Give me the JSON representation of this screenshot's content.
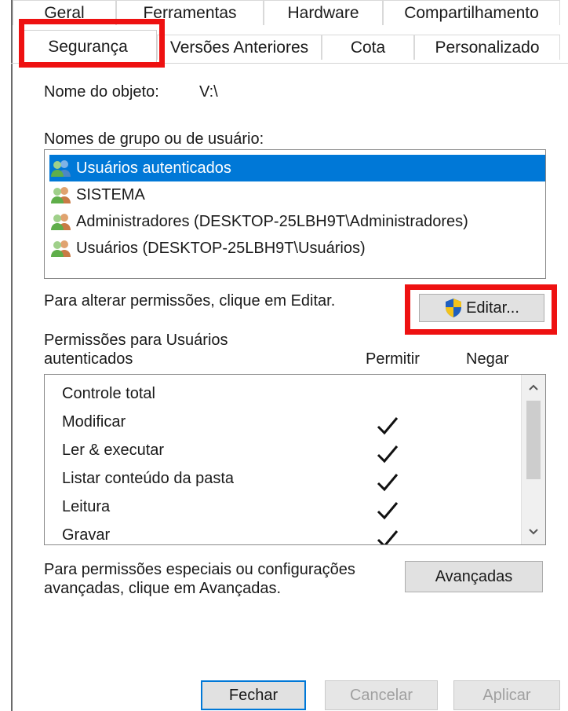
{
  "tabs_back": [
    {
      "label": "Geral"
    },
    {
      "label": "Ferramentas"
    },
    {
      "label": "Hardware"
    },
    {
      "label": "Compartilhamento"
    }
  ],
  "tabs_front": [
    {
      "label": "Segurança"
    },
    {
      "label": "Versões Anteriores"
    },
    {
      "label": "Cota"
    },
    {
      "label": "Personalizado"
    }
  ],
  "object": {
    "label": "Nome do objeto:",
    "value": "V:\\"
  },
  "groups": {
    "label": "Nomes de grupo ou de usuário:",
    "items": [
      {
        "name": "Usuários autenticados"
      },
      {
        "name": "SISTEMA"
      },
      {
        "name": "Administradores (DESKTOP-25LBH9T\\Administradores)"
      },
      {
        "name": "Usuários (DESKTOP-25LBH9T\\Usuários)"
      }
    ]
  },
  "edit": {
    "hint": "Para alterar permissões, clique em Editar.",
    "button_label": "Editar..."
  },
  "permissions": {
    "title_line1": "Permissões para Usuários",
    "title_line2": "autenticados",
    "col_allow": "Permitir",
    "col_deny": "Negar",
    "rows": [
      {
        "name": "Controle total",
        "allow": false,
        "deny": false
      },
      {
        "name": "Modificar",
        "allow": true,
        "deny": false
      },
      {
        "name": "Ler & executar",
        "allow": true,
        "deny": false
      },
      {
        "name": "Listar conteúdo da pasta",
        "allow": true,
        "deny": false
      },
      {
        "name": "Leitura",
        "allow": true,
        "deny": false
      },
      {
        "name": "Gravar",
        "allow": true,
        "deny": false
      }
    ]
  },
  "advanced": {
    "hint_line1": "Para permissões especiais ou configurações",
    "hint_line2": "avançadas, clique em Avançadas.",
    "button_label": "Avançadas"
  },
  "footer": {
    "close_label": "Fechar",
    "cancel_label": "Cancelar",
    "apply_label": "Aplicar"
  },
  "colors": {
    "selection": "#0078d7",
    "highlight": "#ee1111",
    "shield_blue": "#1f5fbf",
    "shield_yellow": "#f3c21a"
  },
  "icons": {
    "group": "users-icon",
    "edit": "uac-shield-icon",
    "check": "checkmark-icon"
  }
}
